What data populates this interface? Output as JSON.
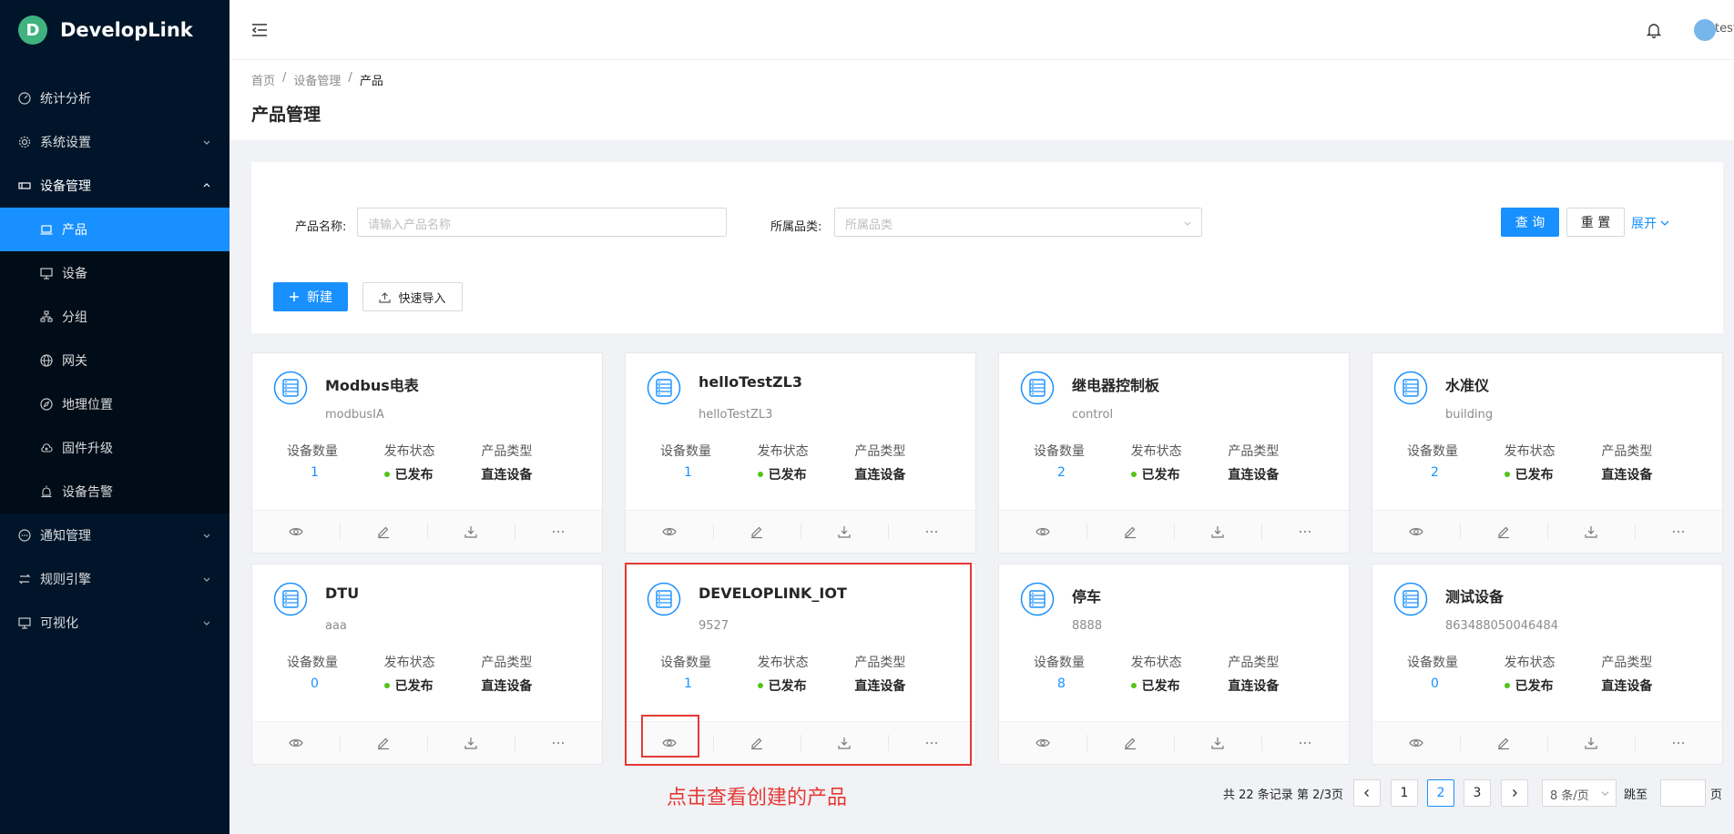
{
  "app": {
    "name": "DevelopLink",
    "logo_letter": "D"
  },
  "sidebar": {
    "items": [
      {
        "label": "统计分析",
        "icon": "dashboard-icon"
      },
      {
        "label": "系统设置",
        "icon": "gear-icon"
      },
      {
        "label": "设备管理",
        "icon": "device-icon"
      },
      {
        "label": "通知管理",
        "icon": "message-icon"
      },
      {
        "label": "规则引擎",
        "icon": "swap-icon"
      },
      {
        "label": "可视化",
        "icon": "monitor-icon"
      }
    ],
    "sub_items": [
      {
        "label": "产品",
        "icon": "laptop-icon"
      },
      {
        "label": "设备",
        "icon": "desktop-icon"
      },
      {
        "label": "分组",
        "icon": "cluster-icon"
      },
      {
        "label": "网关",
        "icon": "globe-icon"
      },
      {
        "label": "地理位置",
        "icon": "compass-icon"
      },
      {
        "label": "固件升级",
        "icon": "cloud-icon"
      },
      {
        "label": "设备告警",
        "icon": "alarm-icon"
      }
    ]
  },
  "header": {
    "username": "test"
  },
  "breadcrumb": {
    "home": "首页",
    "parent": "设备管理",
    "current": "产品"
  },
  "page_title": "产品管理",
  "search": {
    "name_label": "产品名称:",
    "name_placeholder": "请输入产品名称",
    "category_label": "所属品类:",
    "category_placeholder": "所属品类",
    "query_label": "查 询",
    "reset_label": "重 置",
    "expand_label": "展开"
  },
  "toolbar": {
    "new_label": "新建",
    "import_label": "快速导入"
  },
  "stat_labels": {
    "count": "设备数量",
    "status": "发布状态",
    "type": "产品类型"
  },
  "cards": [
    {
      "name": "Modbus电表",
      "sub": "modbusIA",
      "count": "1",
      "status": "已发布",
      "type": "直连设备"
    },
    {
      "name": "helloTestZL3",
      "sub": "helloTestZL3",
      "count": "1",
      "status": "已发布",
      "type": "直连设备"
    },
    {
      "name": "继电器控制板",
      "sub": "control",
      "count": "2",
      "status": "已发布",
      "type": "直连设备"
    },
    {
      "name": "水准仪",
      "sub": "building",
      "count": "2",
      "status": "已发布",
      "type": "直连设备"
    },
    {
      "name": "DTU",
      "sub": "aaa",
      "count": "0",
      "status": "已发布",
      "type": "直连设备"
    },
    {
      "name": "DEVELOPLINK_IOT",
      "sub": "9527",
      "count": "1",
      "status": "已发布",
      "type": "直连设备"
    },
    {
      "name": "停车",
      "sub": "8888",
      "count": "8",
      "status": "已发布",
      "type": "直连设备"
    },
    {
      "name": "测试设备",
      "sub": "863488050046484",
      "count": "0",
      "status": "已发布",
      "type": "直连设备"
    }
  ],
  "annotation": "点击查看创建的产品",
  "pagination": {
    "total_text": "共 22 条记录 第 2/3页",
    "pages": [
      "1",
      "2",
      "3"
    ],
    "current": "2",
    "page_size": "8 条/页",
    "jump_label": "跳至",
    "page_suffix": "页"
  },
  "colors": {
    "primary": "#1890ff",
    "sidebar_bg": "#001529",
    "highlight": "#e53935",
    "published": "#52c41a"
  }
}
